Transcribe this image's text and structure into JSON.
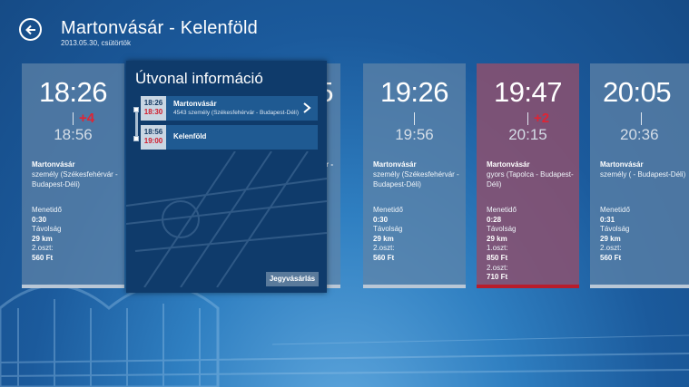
{
  "header": {
    "title": "Martonvásár - Kelenföld",
    "subtitle": "2013.05.30, csütörtök"
  },
  "colors": {
    "background": "#1b5a9c",
    "card": "#6084a8",
    "card_highlight": "#8c506e",
    "delay": "#e02434",
    "panel": "#0f3b6b"
  },
  "cards": [
    {
      "departure": "18:26",
      "delay": "+4",
      "arrival": "18:56",
      "from": "Martonvásár",
      "train": "személy (Székesfehérvár - Budapest-Déli)",
      "duration_label": "Menetidő",
      "duration": "0:30",
      "distance_label": "Távolság",
      "distance": "29 km",
      "class1_label": "",
      "class1_price": "",
      "class2_label": "2.oszt:",
      "class2_price": "560 Ft"
    },
    {
      "departure": "19:26",
      "delay": "",
      "arrival": "19:56",
      "from": "Martonvásár",
      "train": "személy (Székesfehérvár - Budapest-Déli)",
      "duration_label": "Menetidő",
      "duration": "0:30",
      "distance_label": "Távolság",
      "distance": "29 km",
      "class1_label": "",
      "class1_price": "",
      "class2_label": "2.oszt:",
      "class2_price": "560 Ft"
    },
    {
      "departure": "19:47",
      "delay": "+2",
      "arrival": "20:15",
      "from": "Martonvásár",
      "train": "gyors (Tapolca - Budapest-Déli)",
      "duration_label": "Menetidő",
      "duration": "0:28",
      "distance_label": "Távolság",
      "distance": "29 km",
      "class1_label": "1.oszt:",
      "class1_price": "850 Ft",
      "class2_label": "2.oszt:",
      "class2_price": "710 Ft"
    },
    {
      "departure": "20:05",
      "delay": "",
      "arrival": "20:36",
      "from": "Martonvásár",
      "train": "személy ( - Budapest-Déli)",
      "duration_label": "Menetidő",
      "duration": "0:31",
      "distance_label": "Távolság",
      "distance": "29 km",
      "class1_label": "",
      "class1_price": "",
      "class2_label": "2.oszt:",
      "class2_price": "560 Ft"
    }
  ],
  "hidden_card": {
    "partial_time": "5",
    "partial_train": "r -"
  },
  "panel": {
    "title": "Útvonal információ",
    "stops": [
      {
        "time": "18:26",
        "actual": "18:30",
        "name": "Martonvásár",
        "desc": "4543 személy (Székesfehérvár - Budapest-Déli)"
      },
      {
        "time": "18:56",
        "actual": "19:00",
        "name": "Kelenföld",
        "desc": ""
      }
    ],
    "buy_label": "Jegyvásárlás"
  }
}
